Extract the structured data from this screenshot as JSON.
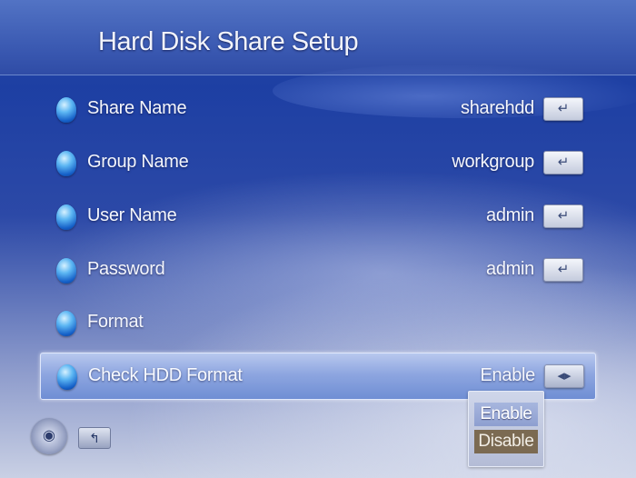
{
  "header": {
    "title": "Hard Disk Share Setup"
  },
  "settings": [
    {
      "label": "Share Name",
      "value": "sharehdd",
      "key": "enter-key-icon"
    },
    {
      "label": "Group Name",
      "value": "workgroup",
      "key": "enter-key-icon"
    },
    {
      "label": "User Name",
      "value": "admin",
      "key": "enter-key-icon"
    },
    {
      "label": "Password",
      "value": "admin",
      "key": "enter-key-icon"
    },
    {
      "label": "Format",
      "value": ""
    },
    {
      "label": "Check HDD Format",
      "value": "Enable",
      "key": "left-right-key-icon",
      "selected": true
    }
  ],
  "dropdown": {
    "options": [
      "Enable",
      "Disable"
    ],
    "highlighted": "Enable"
  },
  "footer": {
    "nav_icon": "dpad-icon",
    "back_icon": "back-icon"
  },
  "glyphs": {
    "enter": "↵",
    "leftright": "◂▸",
    "back": "↰",
    "dpad": "◉"
  },
  "colors": {
    "accent": "#1d3fa3",
    "selected_row": "#8ea6e0",
    "disable_option": "#7b6a52"
  }
}
